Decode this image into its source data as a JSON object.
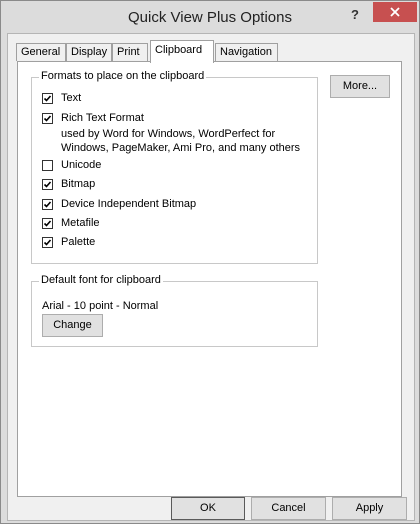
{
  "window": {
    "title": "Quick View Plus Options",
    "help_glyph": "?"
  },
  "tabs": [
    {
      "label": "General"
    },
    {
      "label": "Display"
    },
    {
      "label": "Print"
    },
    {
      "label": "Clipboard"
    },
    {
      "label": "Navigation"
    }
  ],
  "active_tab": "Clipboard",
  "formats": {
    "title": "Formats to place on the clipboard",
    "items": [
      {
        "label": "Text",
        "checked": true
      },
      {
        "label": "Rich Text Format",
        "checked": true
      },
      {
        "label": "Unicode",
        "checked": false
      },
      {
        "label": "Bitmap",
        "checked": true
      },
      {
        "label": "Device Independent Bitmap",
        "checked": true
      },
      {
        "label": "Metafile",
        "checked": true
      },
      {
        "label": "Palette",
        "checked": true
      }
    ],
    "rtf_note_1": "used by Word for Windows, WordPerfect for",
    "rtf_note_2": "Windows, PageMaker, Ami Pro, and many others"
  },
  "more_button": "More...",
  "font_group": {
    "title": "Default font for clipboard",
    "current_font": "Arial - 10 point - Normal",
    "change_button": "Change"
  },
  "dialog_buttons": {
    "ok": "OK",
    "cancel": "Cancel",
    "apply": "Apply"
  }
}
